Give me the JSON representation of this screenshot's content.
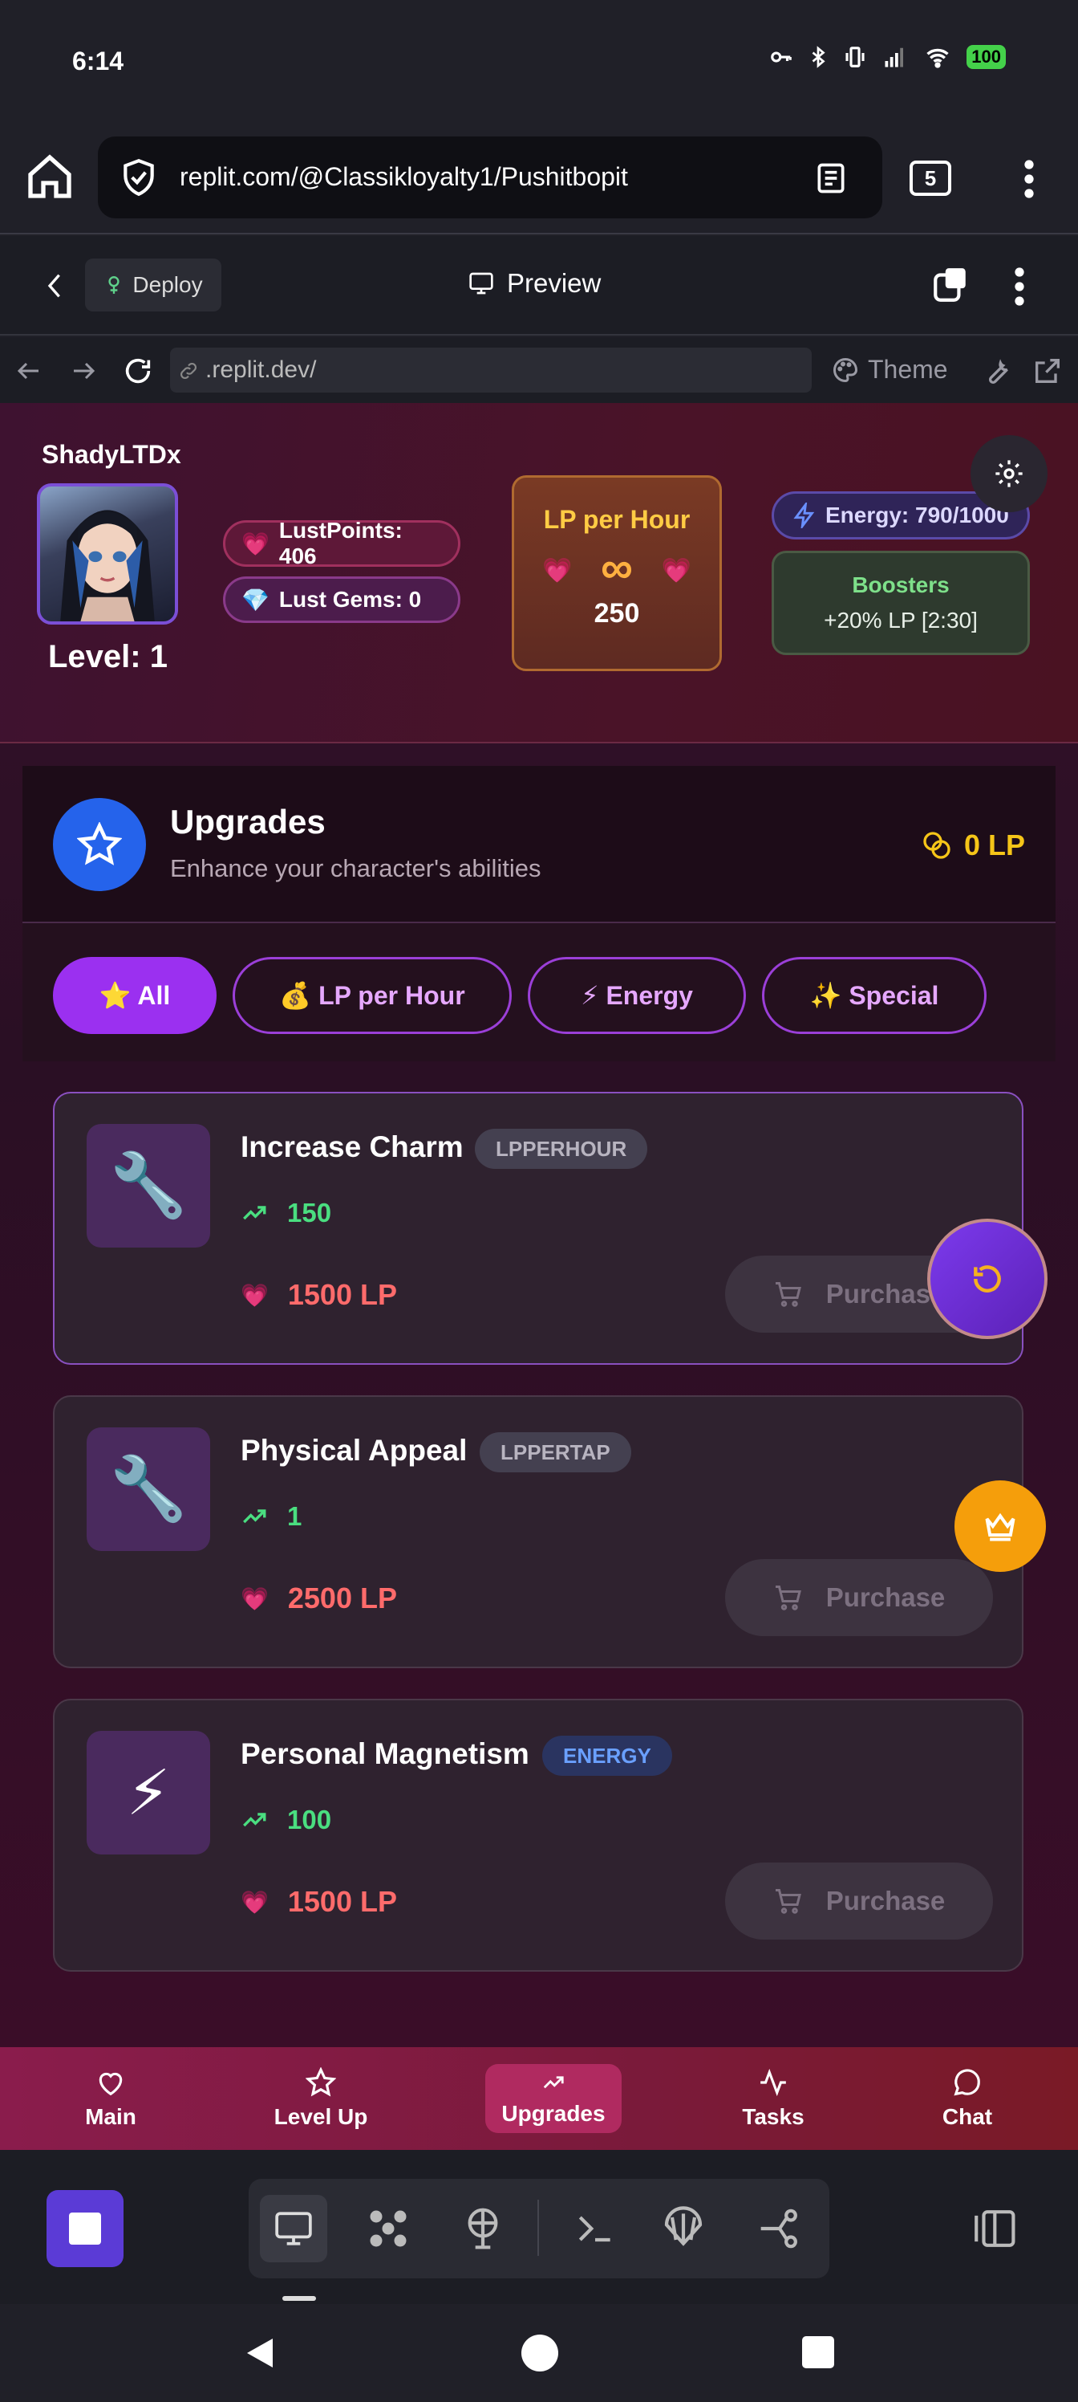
{
  "status_bar": {
    "time": "6:14",
    "battery": "100"
  },
  "browser": {
    "url": "replit.com/@Classikloyalty1/Pushitbopit",
    "tab_count": "5"
  },
  "replit_header": {
    "deploy_label": "Deploy",
    "preview_label": "Preview"
  },
  "replit_toolbar": {
    "address": ".replit.dev/",
    "theme_label": "Theme"
  },
  "player": {
    "username": "ShadyLTDx",
    "level": "Level: 1",
    "lust_points": "LustPoints: 406",
    "lust_gems": "Lust Gems: 0",
    "lp_per_hour_title": "LP per Hour",
    "lp_per_hour_symbol": "∞",
    "lp_per_hour_value": "250",
    "energy": "Energy: 790/1000",
    "boosters_title": "Boosters",
    "boosters_value": "+20% LP [2:30]"
  },
  "upgrades": {
    "title": "Upgrades",
    "subtitle": "Enhance your character's abilities",
    "balance": "0 LP",
    "filters": [
      {
        "label": "⭐ All",
        "active": true
      },
      {
        "label": "💰 LP per Hour",
        "active": false
      },
      {
        "label": "⚡ Energy",
        "active": false
      },
      {
        "label": "✨ Special",
        "active": false
      }
    ],
    "items": [
      {
        "icon": "🔧",
        "icon_name": "wrench-icon",
        "name": "Increase Charm",
        "badge": "LPPERHOUR",
        "increase": "150",
        "cost": "1500 LP",
        "button": "Purchase"
      },
      {
        "icon": "🔧",
        "icon_name": "wrench-icon",
        "name": "Physical Appeal",
        "badge": "LPPERTAP",
        "increase": "1",
        "cost": "2500 LP",
        "button": "Purchase"
      },
      {
        "icon": "⚡",
        "icon_name": "lightning-icon",
        "name": "Personal Magnetism",
        "badge": "ENERGY",
        "increase": "100",
        "cost": "1500 LP",
        "button": "Purchase"
      }
    ]
  },
  "bottom_nav": [
    {
      "label": "Main",
      "icon": "heart-icon"
    },
    {
      "label": "Level Up",
      "icon": "star-icon"
    },
    {
      "label": "Upgrades",
      "icon": "trending-up-icon",
      "active": true
    },
    {
      "label": "Tasks",
      "icon": "activity-icon"
    },
    {
      "label": "Chat",
      "icon": "chat-icon"
    }
  ],
  "colors": {
    "accent": "#9b30f0",
    "gold": "#f5c518",
    "green": "#4ade80",
    "red": "#ff6b6b"
  }
}
